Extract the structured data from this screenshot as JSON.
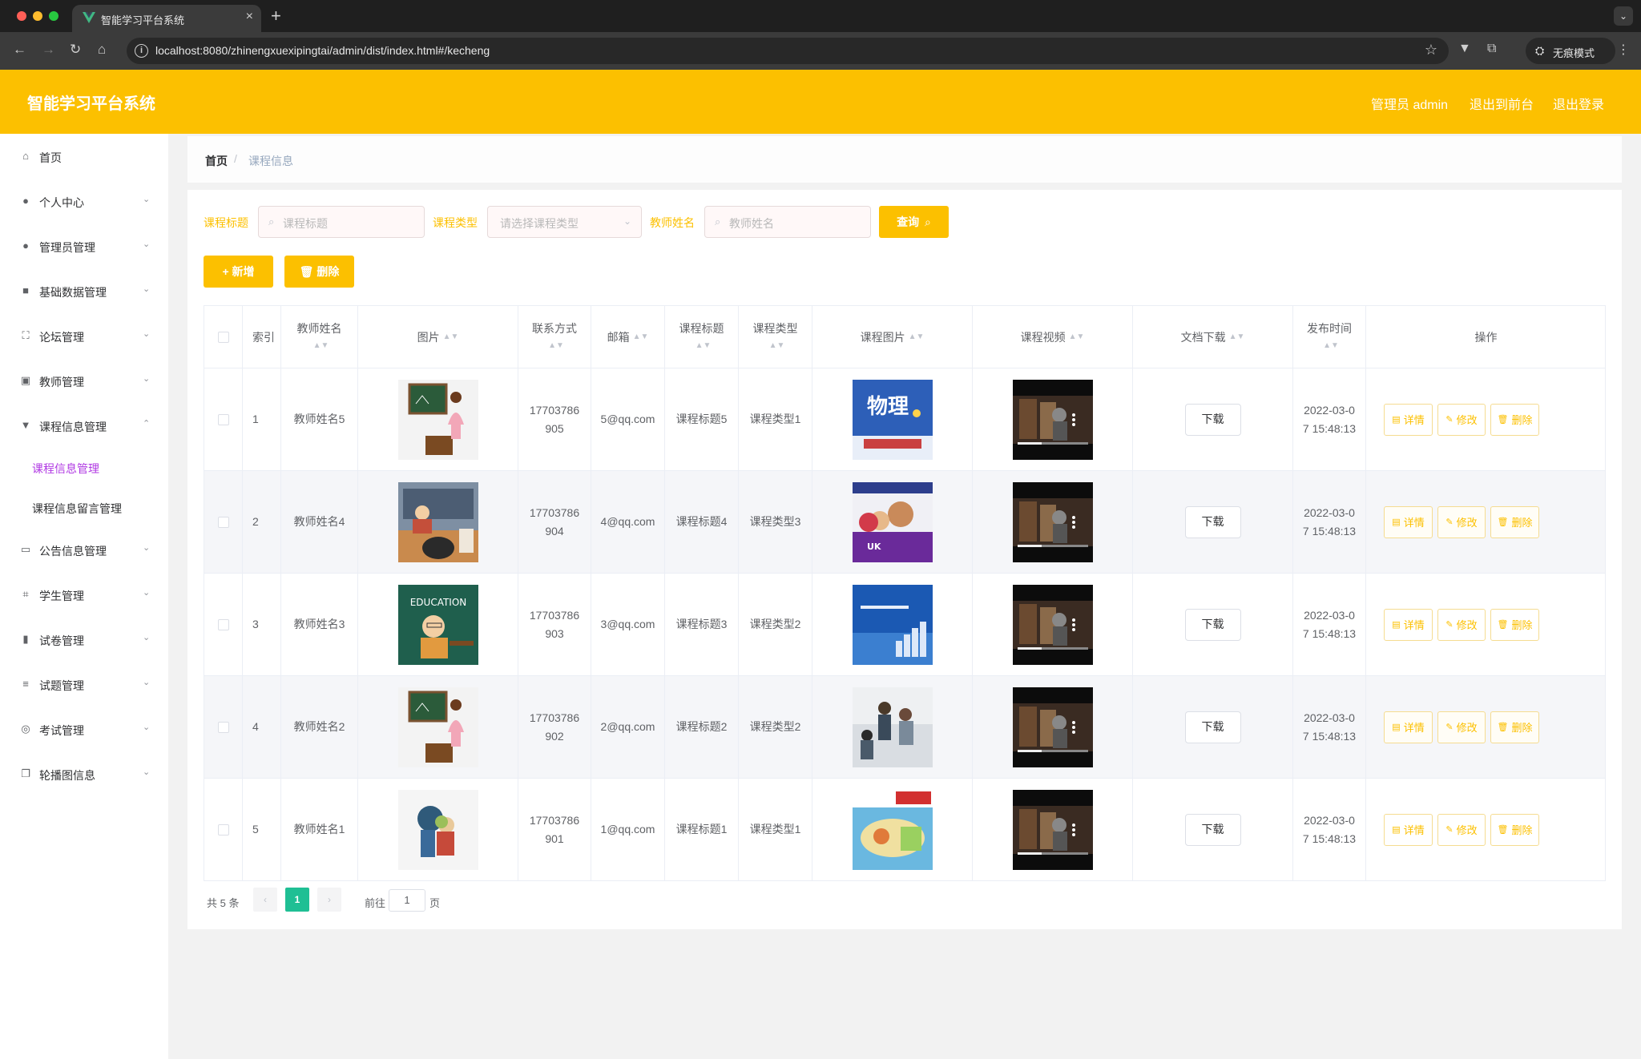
{
  "browser": {
    "tab_title": "智能学习平台系统",
    "url": "localhost:8080/zhinengxuexipingtai/admin/dist/index.html#/kecheng",
    "incognito_label": "无痕模式"
  },
  "header": {
    "title": "智能学习平台系统",
    "user": "管理员 admin",
    "to_front": "退出到前台",
    "logout": "退出登录"
  },
  "sidebar": {
    "items": [
      {
        "label": "首页",
        "icon": "home-icon"
      },
      {
        "label": "个人中心",
        "icon": "user-icon"
      },
      {
        "label": "管理员管理",
        "icon": "bulb-icon"
      },
      {
        "label": "基础数据管理",
        "icon": "camera-icon"
      },
      {
        "label": "论坛管理",
        "icon": "fullscreen-icon"
      },
      {
        "label": "教师管理",
        "icon": "briefcase-icon"
      },
      {
        "label": "课程信息管理",
        "icon": "brush-icon"
      },
      {
        "label": "公告信息管理",
        "icon": "ticket-icon"
      },
      {
        "label": "学生管理",
        "icon": "crop-icon"
      },
      {
        "label": "试卷管理",
        "icon": "bar-chart-icon"
      },
      {
        "label": "试题管理",
        "icon": "menu-icon"
      },
      {
        "label": "考试管理",
        "icon": "compass-icon"
      },
      {
        "label": "轮播图信息",
        "icon": "copy-icon"
      }
    ],
    "sub_items": [
      {
        "label": "课程信息管理"
      },
      {
        "label": "课程信息留言管理"
      }
    ]
  },
  "breadcrumb": {
    "home": "首页",
    "sep": "/",
    "current": "课程信息"
  },
  "filters": {
    "title_label": "课程标题",
    "title_placeholder": "课程标题",
    "type_label": "课程类型",
    "type_placeholder": "请选择课程类型",
    "teacher_label": "教师姓名",
    "teacher_placeholder": "教师姓名",
    "search_label": "查询"
  },
  "actions": {
    "add_label": "新增",
    "delete_label": "删除"
  },
  "table": {
    "headers": {
      "index": "索引",
      "teacher": "教师姓名",
      "image": "图片",
      "phone": "联系方式",
      "email": "邮箱",
      "title": "课程标题",
      "type": "课程类型",
      "course_image": "课程图片",
      "course_video": "课程视频",
      "doc": "文档下载",
      "time": "发布时间",
      "ops": "操作"
    },
    "download_label": "下载",
    "op_detail": "详情",
    "op_edit": "修改",
    "op_delete": "删除",
    "course_image_text": "物理",
    "rows": [
      {
        "index": "1",
        "teacher": "教师姓名5",
        "phone": "17703786905",
        "email": "5@qq.com",
        "title": "课程标题5",
        "type": "课程类型1",
        "time": "2022-03-07 15:48:13"
      },
      {
        "index": "2",
        "teacher": "教师姓名4",
        "phone": "17703786904",
        "email": "4@qq.com",
        "title": "课程标题4",
        "type": "课程类型3",
        "time": "2022-03-07 15:48:13"
      },
      {
        "index": "3",
        "teacher": "教师姓名3",
        "phone": "17703786903",
        "email": "3@qq.com",
        "title": "课程标题3",
        "type": "课程类型2",
        "time": "2022-03-07 15:48:13"
      },
      {
        "index": "4",
        "teacher": "教师姓名2",
        "phone": "17703786902",
        "email": "2@qq.com",
        "title": "课程标题2",
        "type": "课程类型2",
        "time": "2022-03-07 15:48:13"
      },
      {
        "index": "5",
        "teacher": "教师姓名1",
        "phone": "17703786901",
        "email": "1@qq.com",
        "title": "课程标题1",
        "type": "课程类型1",
        "time": "2022-03-07 15:48:13"
      }
    ]
  },
  "pagination": {
    "total": "共 5 条",
    "prev": "‹",
    "current_page": "1",
    "next": "›",
    "goto": "前往",
    "goto_value": "1",
    "page_unit": "页"
  },
  "colors": {
    "accent": "#fcc000",
    "page_active": "#1fbf94",
    "submenu_active": "#b039e3"
  }
}
